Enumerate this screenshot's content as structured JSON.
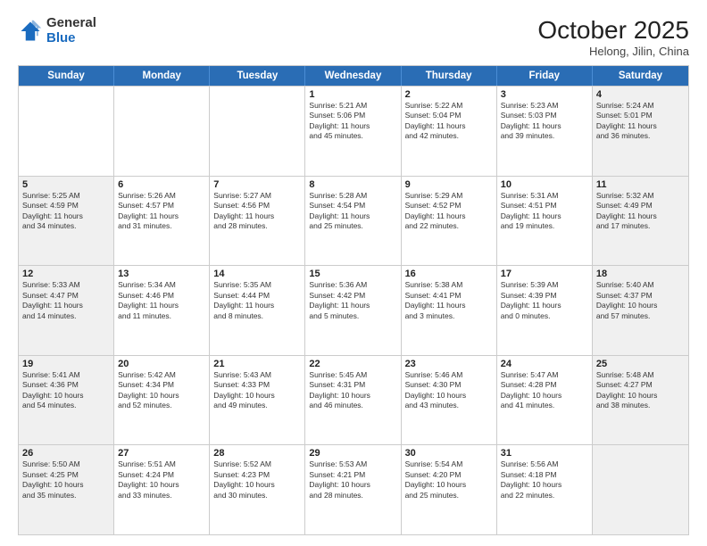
{
  "header": {
    "logo_general": "General",
    "logo_blue": "Blue",
    "month_title": "October 2025",
    "subtitle": "Helong, Jilin, China"
  },
  "days_of_week": [
    "Sunday",
    "Monday",
    "Tuesday",
    "Wednesday",
    "Thursday",
    "Friday",
    "Saturday"
  ],
  "rows": [
    [
      {
        "day": "",
        "info": "",
        "shaded": false
      },
      {
        "day": "",
        "info": "",
        "shaded": false
      },
      {
        "day": "",
        "info": "",
        "shaded": false
      },
      {
        "day": "1",
        "info": "Sunrise: 5:21 AM\nSunset: 5:06 PM\nDaylight: 11 hours\nand 45 minutes.",
        "shaded": false
      },
      {
        "day": "2",
        "info": "Sunrise: 5:22 AM\nSunset: 5:04 PM\nDaylight: 11 hours\nand 42 minutes.",
        "shaded": false
      },
      {
        "day": "3",
        "info": "Sunrise: 5:23 AM\nSunset: 5:03 PM\nDaylight: 11 hours\nand 39 minutes.",
        "shaded": false
      },
      {
        "day": "4",
        "info": "Sunrise: 5:24 AM\nSunset: 5:01 PM\nDaylight: 11 hours\nand 36 minutes.",
        "shaded": true
      }
    ],
    [
      {
        "day": "5",
        "info": "Sunrise: 5:25 AM\nSunset: 4:59 PM\nDaylight: 11 hours\nand 34 minutes.",
        "shaded": true
      },
      {
        "day": "6",
        "info": "Sunrise: 5:26 AM\nSunset: 4:57 PM\nDaylight: 11 hours\nand 31 minutes.",
        "shaded": false
      },
      {
        "day": "7",
        "info": "Sunrise: 5:27 AM\nSunset: 4:56 PM\nDaylight: 11 hours\nand 28 minutes.",
        "shaded": false
      },
      {
        "day": "8",
        "info": "Sunrise: 5:28 AM\nSunset: 4:54 PM\nDaylight: 11 hours\nand 25 minutes.",
        "shaded": false
      },
      {
        "day": "9",
        "info": "Sunrise: 5:29 AM\nSunset: 4:52 PM\nDaylight: 11 hours\nand 22 minutes.",
        "shaded": false
      },
      {
        "day": "10",
        "info": "Sunrise: 5:31 AM\nSunset: 4:51 PM\nDaylight: 11 hours\nand 19 minutes.",
        "shaded": false
      },
      {
        "day": "11",
        "info": "Sunrise: 5:32 AM\nSunset: 4:49 PM\nDaylight: 11 hours\nand 17 minutes.",
        "shaded": true
      }
    ],
    [
      {
        "day": "12",
        "info": "Sunrise: 5:33 AM\nSunset: 4:47 PM\nDaylight: 11 hours\nand 14 minutes.",
        "shaded": true
      },
      {
        "day": "13",
        "info": "Sunrise: 5:34 AM\nSunset: 4:46 PM\nDaylight: 11 hours\nand 11 minutes.",
        "shaded": false
      },
      {
        "day": "14",
        "info": "Sunrise: 5:35 AM\nSunset: 4:44 PM\nDaylight: 11 hours\nand 8 minutes.",
        "shaded": false
      },
      {
        "day": "15",
        "info": "Sunrise: 5:36 AM\nSunset: 4:42 PM\nDaylight: 11 hours\nand 5 minutes.",
        "shaded": false
      },
      {
        "day": "16",
        "info": "Sunrise: 5:38 AM\nSunset: 4:41 PM\nDaylight: 11 hours\nand 3 minutes.",
        "shaded": false
      },
      {
        "day": "17",
        "info": "Sunrise: 5:39 AM\nSunset: 4:39 PM\nDaylight: 11 hours\nand 0 minutes.",
        "shaded": false
      },
      {
        "day": "18",
        "info": "Sunrise: 5:40 AM\nSunset: 4:37 PM\nDaylight: 10 hours\nand 57 minutes.",
        "shaded": true
      }
    ],
    [
      {
        "day": "19",
        "info": "Sunrise: 5:41 AM\nSunset: 4:36 PM\nDaylight: 10 hours\nand 54 minutes.",
        "shaded": true
      },
      {
        "day": "20",
        "info": "Sunrise: 5:42 AM\nSunset: 4:34 PM\nDaylight: 10 hours\nand 52 minutes.",
        "shaded": false
      },
      {
        "day": "21",
        "info": "Sunrise: 5:43 AM\nSunset: 4:33 PM\nDaylight: 10 hours\nand 49 minutes.",
        "shaded": false
      },
      {
        "day": "22",
        "info": "Sunrise: 5:45 AM\nSunset: 4:31 PM\nDaylight: 10 hours\nand 46 minutes.",
        "shaded": false
      },
      {
        "day": "23",
        "info": "Sunrise: 5:46 AM\nSunset: 4:30 PM\nDaylight: 10 hours\nand 43 minutes.",
        "shaded": false
      },
      {
        "day": "24",
        "info": "Sunrise: 5:47 AM\nSunset: 4:28 PM\nDaylight: 10 hours\nand 41 minutes.",
        "shaded": false
      },
      {
        "day": "25",
        "info": "Sunrise: 5:48 AM\nSunset: 4:27 PM\nDaylight: 10 hours\nand 38 minutes.",
        "shaded": true
      }
    ],
    [
      {
        "day": "26",
        "info": "Sunrise: 5:50 AM\nSunset: 4:25 PM\nDaylight: 10 hours\nand 35 minutes.",
        "shaded": true
      },
      {
        "day": "27",
        "info": "Sunrise: 5:51 AM\nSunset: 4:24 PM\nDaylight: 10 hours\nand 33 minutes.",
        "shaded": false
      },
      {
        "day": "28",
        "info": "Sunrise: 5:52 AM\nSunset: 4:23 PM\nDaylight: 10 hours\nand 30 minutes.",
        "shaded": false
      },
      {
        "day": "29",
        "info": "Sunrise: 5:53 AM\nSunset: 4:21 PM\nDaylight: 10 hours\nand 28 minutes.",
        "shaded": false
      },
      {
        "day": "30",
        "info": "Sunrise: 5:54 AM\nSunset: 4:20 PM\nDaylight: 10 hours\nand 25 minutes.",
        "shaded": false
      },
      {
        "day": "31",
        "info": "Sunrise: 5:56 AM\nSunset: 4:18 PM\nDaylight: 10 hours\nand 22 minutes.",
        "shaded": false
      },
      {
        "day": "",
        "info": "",
        "shaded": true
      }
    ]
  ]
}
